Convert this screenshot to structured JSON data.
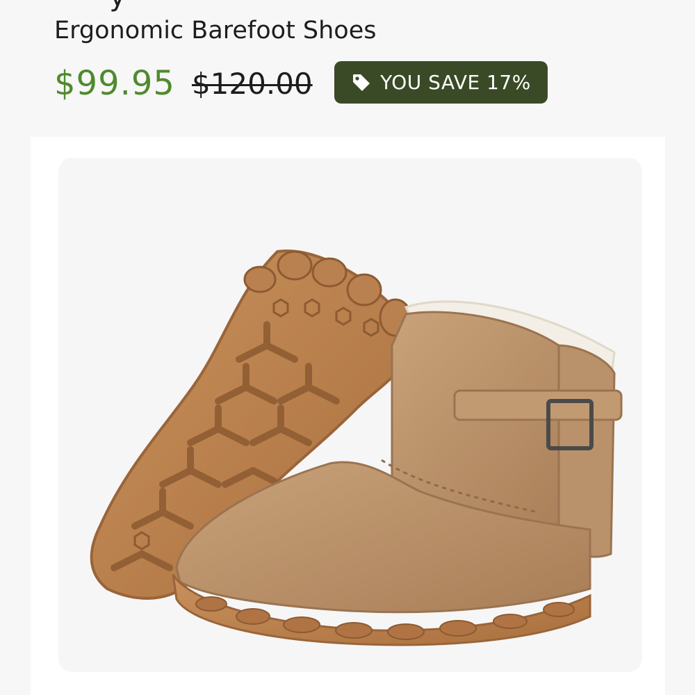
{
  "product": {
    "title_partial": "· · ·     y",
    "title": "Ergonomic Barefoot Shoes",
    "price": "$99.95",
    "compare_at_price": "$120.00",
    "badge": {
      "icon": "tag-icon",
      "label": "YOU SAVE 17%"
    },
    "image": {
      "alt": "Tan suede barefoot winter boots with buckle strap and sole tread",
      "icon": "product-image"
    }
  },
  "colors": {
    "sale_price": "#4f8a2d",
    "badge_background": "#3a4a26",
    "text": "#1d1d1d",
    "page_background": "#f7f7f7",
    "card_background": "#ffffff"
  }
}
